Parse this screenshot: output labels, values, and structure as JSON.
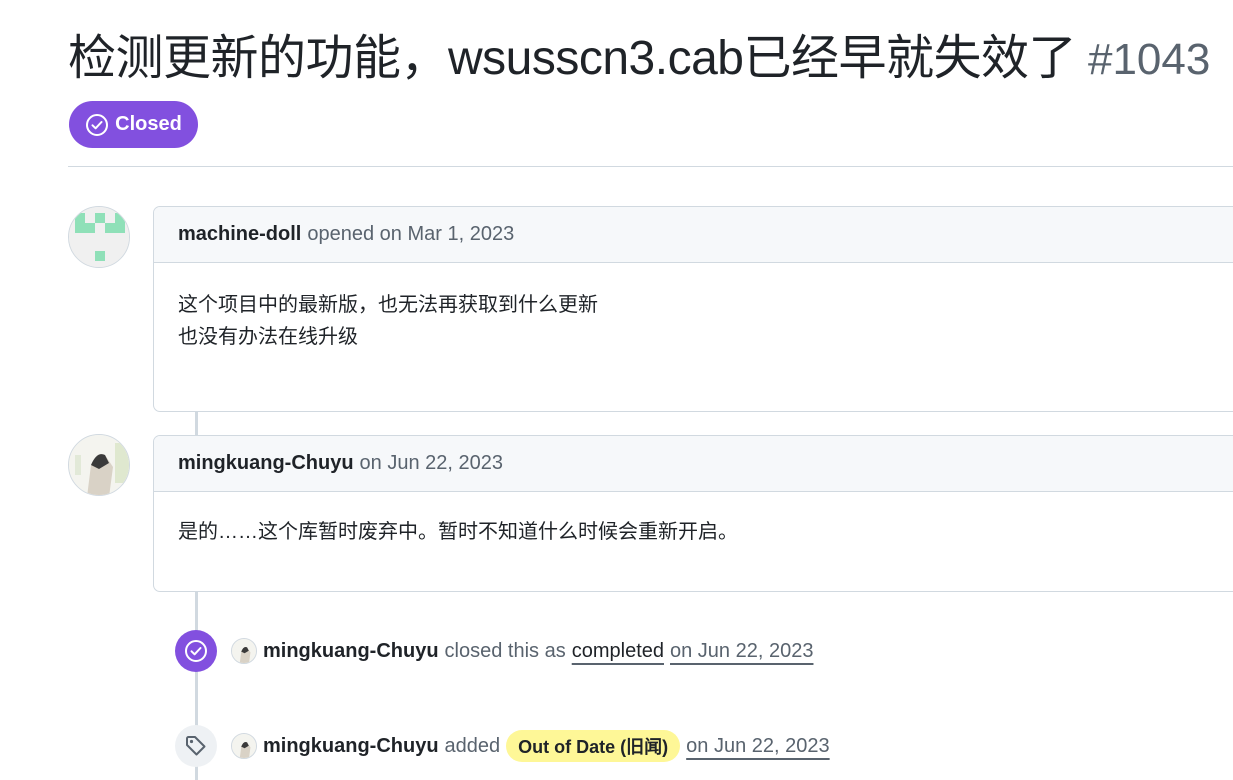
{
  "issue": {
    "title": "检测更新的功能，wsusscn3.cab已经早就失效了",
    "number": "#1043",
    "state": "Closed",
    "state_color": "#8250df"
  },
  "comments": [
    {
      "author": "machine-doll",
      "meta": "opened on Mar 1, 2023",
      "body_lines": [
        "这个项目中的最新版，也无法再获取到什么更新",
        "也没有办法在线升级"
      ]
    },
    {
      "author": "mingkuang-Chuyu",
      "meta": "on Jun 22, 2023",
      "body_lines": [
        "是的……这个库暂时废弃中。暂时不知道什么时候会重新开启。"
      ]
    }
  ],
  "events": [
    {
      "icon": "check-circle-icon",
      "author": "mingkuang-Chuyu",
      "action": "closed this as",
      "link": "completed",
      "date": "on Jun 22, 2023"
    },
    {
      "icon": "tag-icon",
      "author": "mingkuang-Chuyu",
      "action": "added",
      "label": "Out of Date (旧闻)",
      "label_color": "#fef797",
      "date": "on Jun 22, 2023"
    }
  ]
}
